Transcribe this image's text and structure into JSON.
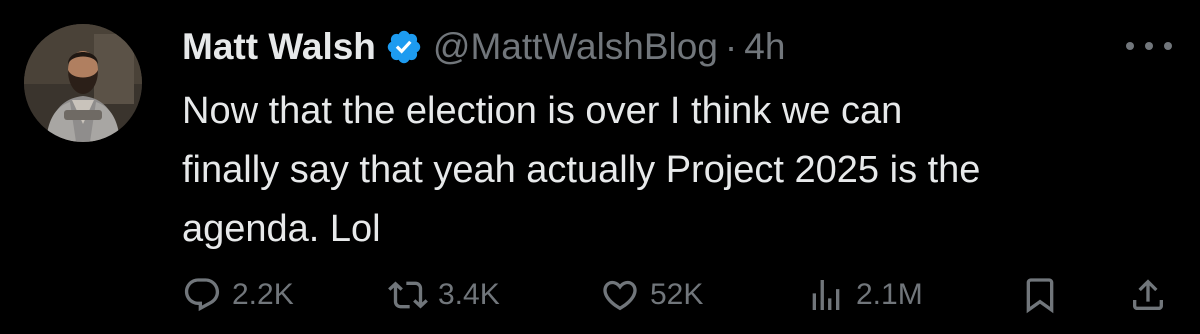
{
  "tweet": {
    "author_name": "Matt Walsh",
    "handle": "@MattWalshBlog",
    "separator": "·",
    "time": "4h",
    "text_lines": [
      "Now that the election is over I think we can",
      "finally say that yeah actually Project 2025 is the",
      "agenda. Lol"
    ]
  },
  "actions": {
    "replies": "2.2K",
    "reposts": "3.4K",
    "likes": "52K",
    "views": "2.1M"
  },
  "colors": {
    "background": "#000000",
    "text": "#e7e9ea",
    "secondary": "#71767b",
    "verified": "#1d9bf0"
  },
  "icons": [
    "avatar",
    "verified-badge-icon",
    "more-icon",
    "reply-icon",
    "repost-icon",
    "like-icon",
    "views-icon",
    "bookmark-icon",
    "share-icon"
  ]
}
